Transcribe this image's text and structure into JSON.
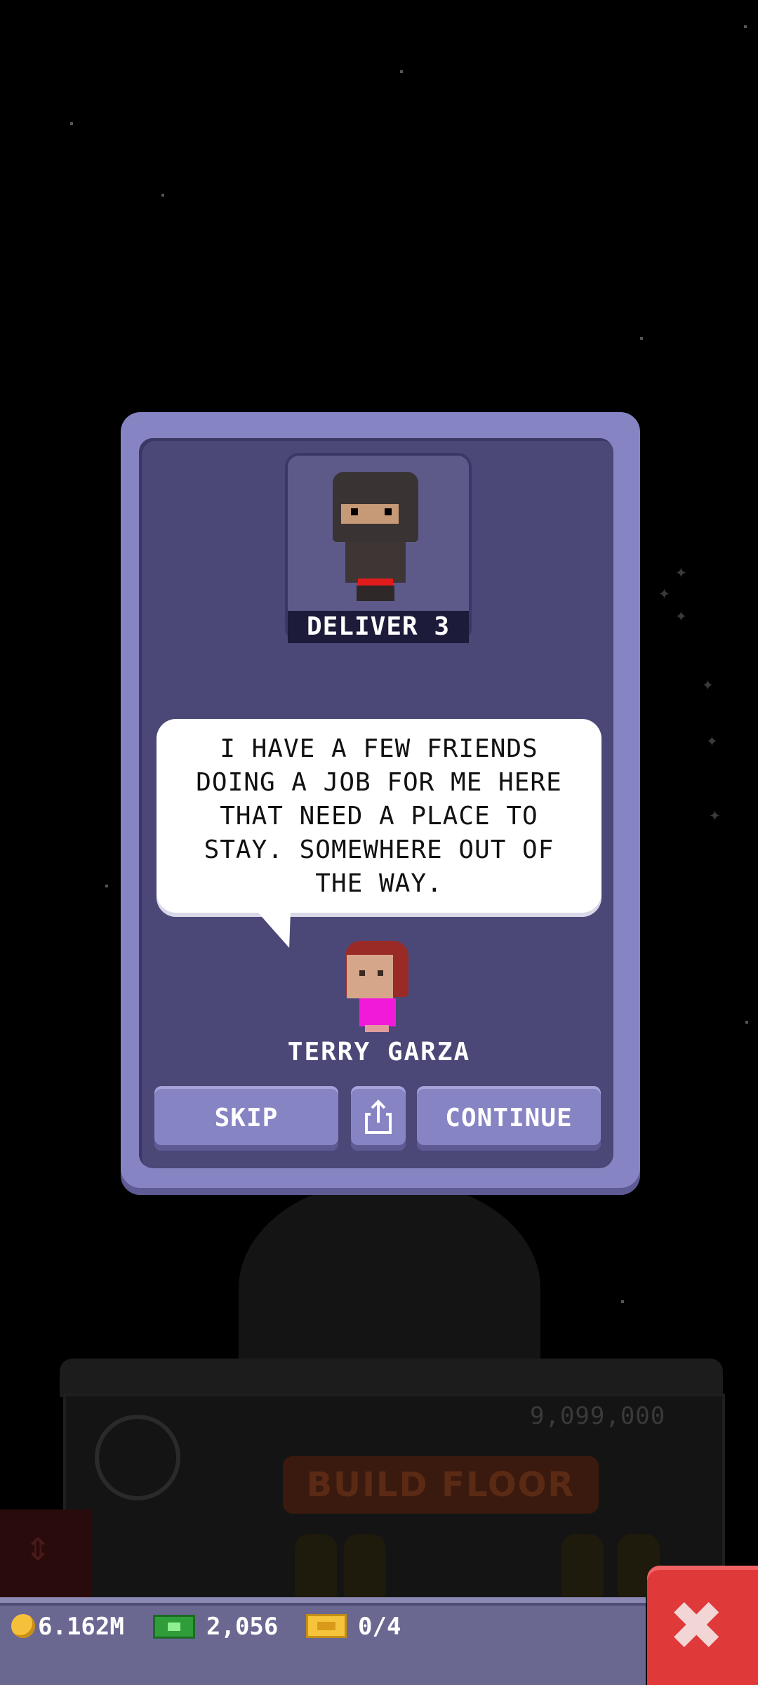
{
  "colors": {
    "modal_frame": "#8784c4",
    "modal_panel": "#4b4878",
    "close_button": "#e0393a",
    "hud_bar": "#6a6891"
  },
  "background": {
    "cost": "9,099,000",
    "build_floor_label": "BUILD FLOOR"
  },
  "modal": {
    "portrait_label": "DELIVER 3",
    "message": "I HAVE A FEW FRIENDS\nDOING A JOB FOR ME HERE\nTHAT NEED A PLACE TO\nSTAY. SOMEWHERE OUT OF\nTHE WAY.",
    "speaker_name": "TERRY GARZA",
    "skip_label": "SKIP",
    "share_icon": "share-icon",
    "continue_label": "CONTINUE"
  },
  "hud": {
    "coins": "6.162M",
    "bux": "2,056",
    "tickets": "0/4",
    "close_icon": "close-icon"
  }
}
